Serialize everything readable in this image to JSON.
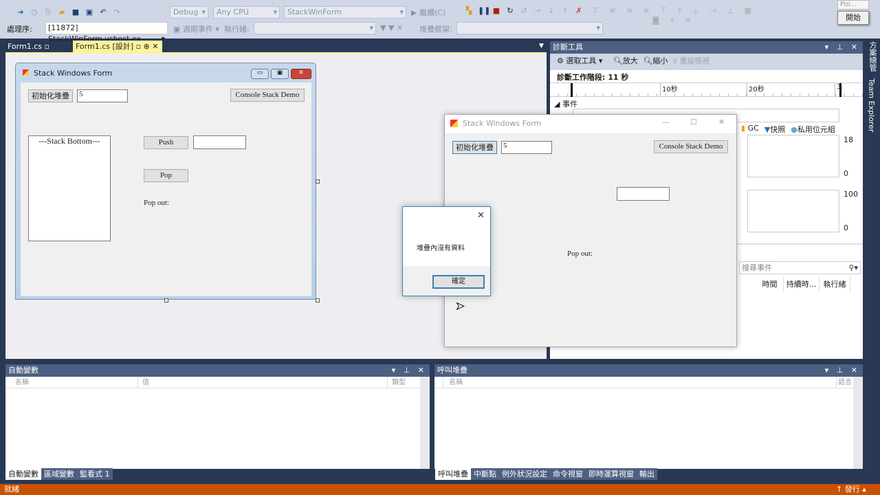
{
  "toolbar": {
    "config": "Debug",
    "platform": "Any CPU",
    "startup": "StackWinForm",
    "continue": "繼續(C)",
    "process_label": "處理序:",
    "process": "[11872] StackWinForm.vshost.ex",
    "lifecycle": "週期事件",
    "thread_label": "執行緒:",
    "stackframe_label": "堆疊框架:"
  },
  "popup": {
    "title": "Poi...",
    "button": "開始"
  },
  "doc_tabs": [
    {
      "label": "Form1.cs"
    },
    {
      "label": "Form1.cs [設計]"
    }
  ],
  "designer_form": {
    "title": "Stack Windows Form",
    "init_button": "初始化堆疊",
    "init_value": "5",
    "console_button": "Console Stack Demo",
    "list_item": "---Stack Bottom---",
    "push_button": "Push",
    "push_value": "",
    "pop_button": "Pop",
    "pop_out_label": "Pop out:"
  },
  "running_form": {
    "title": "Stack Windows Form",
    "init_button": "初始化堆疊",
    "init_value": "5",
    "console_button": "Console Stack Demo",
    "pop_out_label": "Pop out:"
  },
  "messagebox": {
    "message": "堆疊內沒有資料",
    "ok_button": "確定"
  },
  "diagnostics": {
    "title": "診斷工具",
    "select_tool": "選取工具",
    "zoom_in": "放大",
    "zoom_out": "縮小",
    "reset_view": "重設檢視",
    "session": "診斷工作階段: 11 秒",
    "ticks": [
      "10秒",
      "20秒",
      "3"
    ],
    "events_label": "事件",
    "legend": [
      {
        "label": "GC",
        "color": "#f0a30a"
      },
      {
        "label": "快照",
        "color": "#1e6fc4"
      },
      {
        "label": "私用位元組",
        "color": "#68a7cf"
      }
    ],
    "mem_max": "18",
    "mem_min": "0",
    "cpu_max": "100",
    "cpu_min": "0",
    "search_placeholder": "搜尋事件",
    "columns": [
      "時間",
      "持續時...",
      "執行緒"
    ]
  },
  "side_tabs": [
    "方案總管",
    "Team Explorer"
  ],
  "autos": {
    "title": "自動變數",
    "columns": [
      "名稱",
      "值",
      "類型"
    ],
    "tabs": [
      "自動變數",
      "區域變數",
      "監看式 1"
    ]
  },
  "callstack": {
    "title": "呼叫堆疊",
    "columns": [
      "名稱",
      "語言"
    ],
    "tabs": [
      "呼叫堆疊",
      "中斷點",
      "例外狀況設定",
      "命令視窗",
      "即時運算視窗",
      "輸出"
    ]
  },
  "status": {
    "text": "就緒",
    "publish": "發行"
  }
}
